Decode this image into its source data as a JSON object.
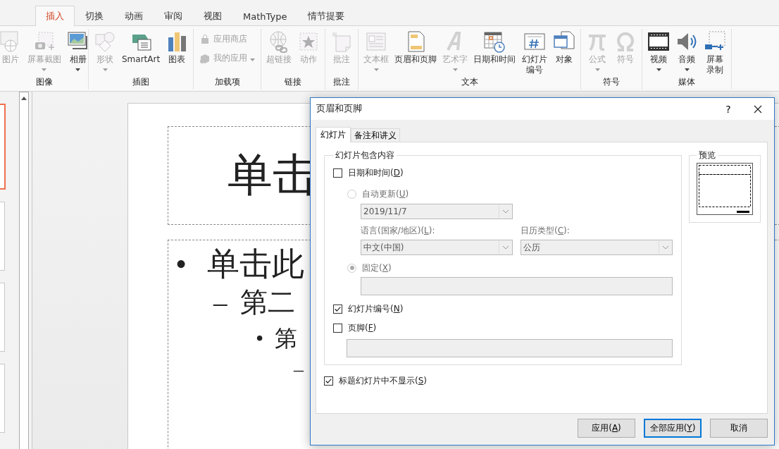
{
  "ribbon_tabs": [
    {
      "label": "插入",
      "selected": true
    },
    {
      "label": "切换",
      "selected": false
    },
    {
      "label": "动画",
      "selected": false
    },
    {
      "label": "审阅",
      "selected": false
    },
    {
      "label": "视图",
      "selected": false
    },
    {
      "label": "MathType",
      "selected": false
    },
    {
      "label": "情节提要",
      "selected": false
    }
  ],
  "ribbon_groups": [
    {
      "label": "图像",
      "items": [
        {
          "kind": "large",
          "label": "图片",
          "disabled": true,
          "dropdown": false
        },
        {
          "kind": "large",
          "label": "屏幕截图",
          "disabled": true,
          "dropdown": true
        },
        {
          "kind": "large",
          "label": "相册",
          "disabled": false,
          "dropdown": true
        }
      ]
    },
    {
      "label": "插图",
      "items": [
        {
          "kind": "large",
          "label": "形状",
          "disabled": true,
          "dropdown": true
        },
        {
          "kind": "large",
          "label": "SmartArt",
          "disabled": false,
          "dropdown": false
        },
        {
          "kind": "large",
          "label": "图表",
          "disabled": false,
          "dropdown": false
        }
      ]
    },
    {
      "label": "加载项",
      "items": [
        {
          "kind": "small",
          "label": "应用商店",
          "disabled": true,
          "dropdown": false
        },
        {
          "kind": "small",
          "label": "我的应用",
          "disabled": true,
          "dropdown": true
        }
      ]
    },
    {
      "label": "链接",
      "items": [
        {
          "kind": "large",
          "label": "超链接",
          "disabled": true,
          "dropdown": false
        },
        {
          "kind": "large",
          "label": "动作",
          "disabled": true,
          "dropdown": false
        }
      ]
    },
    {
      "label": "批注",
      "items": [
        {
          "kind": "large",
          "label": "批注",
          "disabled": true,
          "dropdown": false
        }
      ]
    },
    {
      "label": "文本",
      "items": [
        {
          "kind": "large",
          "label": "文本框",
          "disabled": true,
          "dropdown": true
        },
        {
          "kind": "large",
          "label": "页眉和页脚",
          "disabled": false,
          "dropdown": false
        },
        {
          "kind": "large",
          "label": "艺术字",
          "disabled": true,
          "dropdown": true
        },
        {
          "kind": "large",
          "label": "日期和时间",
          "disabled": false,
          "dropdown": false
        },
        {
          "kind": "large",
          "label": "幻灯片编号",
          "disabled": false,
          "dropdown": false
        },
        {
          "kind": "large",
          "label": "对象",
          "disabled": false,
          "dropdown": false
        }
      ]
    },
    {
      "label": "符号",
      "items": [
        {
          "kind": "large",
          "label": "公式",
          "disabled": true,
          "dropdown": true
        },
        {
          "kind": "large",
          "label": "符号",
          "disabled": true,
          "dropdown": false
        }
      ]
    },
    {
      "label": "媒体",
      "items": [
        {
          "kind": "large",
          "label": "视频",
          "disabled": false,
          "dropdown": true
        },
        {
          "kind": "large",
          "label": "音频",
          "disabled": false,
          "dropdown": true
        },
        {
          "kind": "large",
          "label": "屏幕录制",
          "disabled": false,
          "dropdown": false
        }
      ]
    }
  ],
  "thumbnails": [
    {
      "selected": true
    },
    {
      "selected": false
    },
    {
      "selected": false
    },
    {
      "selected": false
    }
  ],
  "slide": {
    "title": "单击",
    "body": [
      {
        "marker": "•",
        "text": "单击此",
        "children": [
          {
            "marker": "–",
            "text": "第二",
            "children": [
              {
                "marker": "•",
                "text": "第",
                "children": [
                  {
                    "marker": "–"
                  }
                ]
              }
            ]
          }
        ]
      }
    ]
  },
  "dialog": {
    "title": "页眉和页脚",
    "help": "?",
    "tabs": [
      {
        "label": "幻灯片",
        "selected": true
      },
      {
        "label": "备注和讲义",
        "selected": false
      }
    ],
    "include_group": {
      "legend": "幻灯片包含内容",
      "date_time": {
        "label": "日期和时间(D)",
        "checked": false
      },
      "auto_update": {
        "label": "自动更新(U)",
        "selected": false,
        "disabled": true
      },
      "date_format": {
        "value": "2019/11/7",
        "disabled": true
      },
      "language": {
        "label": "语言(国家/地区)(L):",
        "value": "中文(中国)",
        "disabled": true
      },
      "calendar": {
        "label": "日历类型(C):",
        "value": "公历",
        "disabled": true
      },
      "fixed": {
        "label": "固定(X)",
        "selected": true,
        "disabled": true
      },
      "fixed_field": {
        "disabled": true
      },
      "slide_number": {
        "label": "幻灯片编号(N)",
        "checked": true
      },
      "footer": {
        "label": "页脚(F)",
        "checked": false
      },
      "footer_field": {
        "disabled": true
      }
    },
    "hide_on_title": {
      "label": "标题幻灯片中不显示(S)",
      "checked": true
    },
    "preview": {
      "legend": "预览"
    },
    "buttons": [
      {
        "label": "应用(A)",
        "default": false
      },
      {
        "label": "全部应用(Y)",
        "default": true
      },
      {
        "label": "取消",
        "default": false
      }
    ]
  }
}
